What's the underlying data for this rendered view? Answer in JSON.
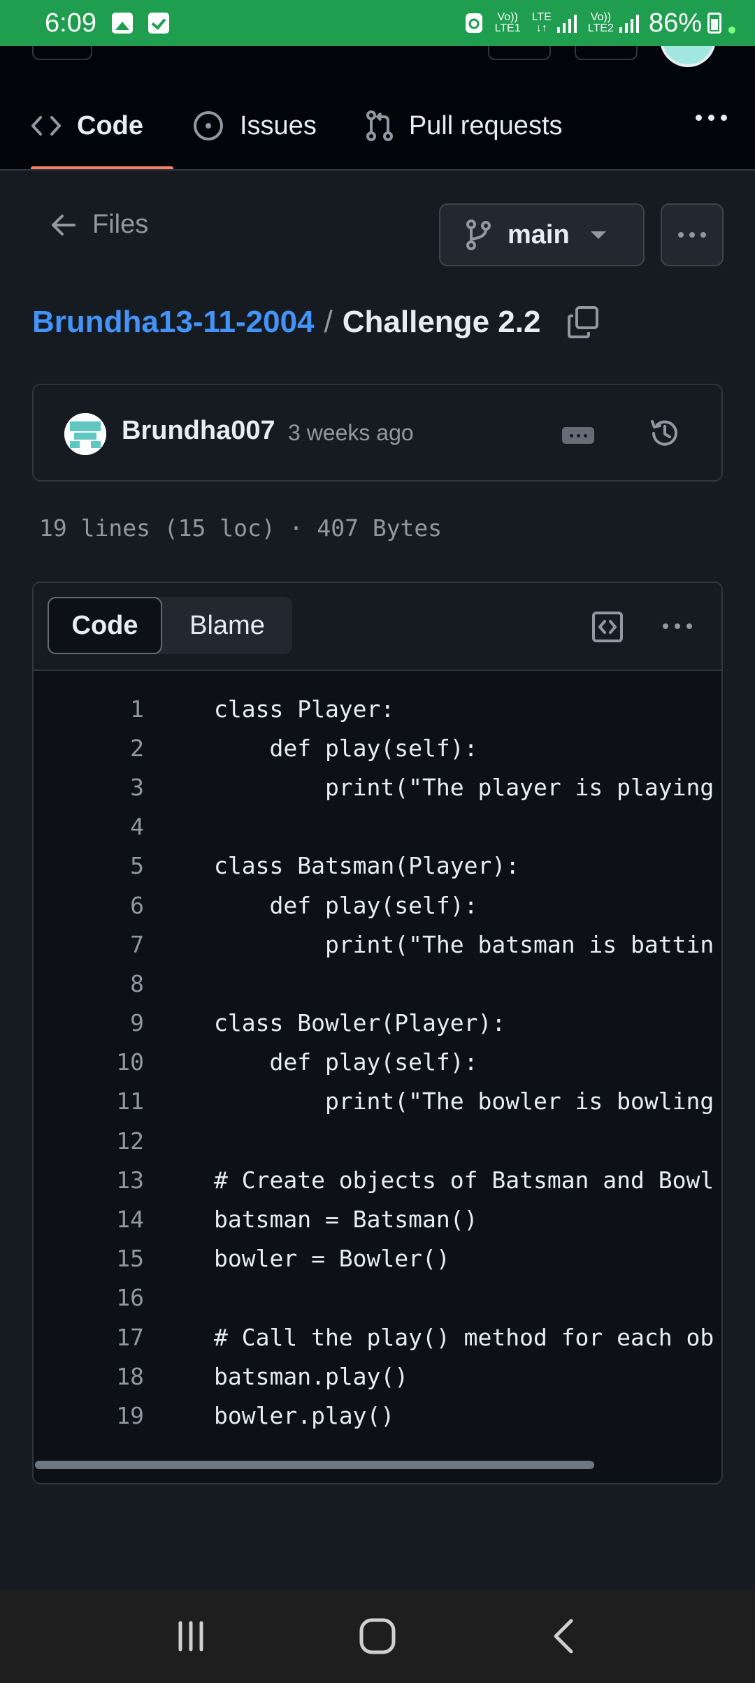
{
  "status_bar": {
    "time": "6:09",
    "net1_top": "Vo))",
    "net1_bottom": "LTE1",
    "net_lte_top": "LTE",
    "net_lte_bottom": "↓↑",
    "net2_top": "Vo))",
    "net2_bottom": "LTE2",
    "battery": "86%"
  },
  "repo_header": {
    "tabs": [
      {
        "label": "Code",
        "icon": "code-icon",
        "active": true
      },
      {
        "label": "Issues",
        "icon": "issue-icon",
        "active": false
      },
      {
        "label": "Pull requests",
        "icon": "pull-request-icon",
        "active": false
      }
    ],
    "more_icon": "kebab-horizontal-icon"
  },
  "nav": {
    "back_label": "Files",
    "branch": "main"
  },
  "breadcrumb": {
    "repo": "Brundha13-11-2004",
    "separator": "/",
    "file": "Challenge 2.2"
  },
  "commit": {
    "author": "Brundha007",
    "time": "3 weeks ago"
  },
  "file_info": "19 lines (15 loc) · 407 Bytes",
  "code_view": {
    "tab_code": "Code",
    "tab_blame": "Blame",
    "lines": [
      {
        "n": "1",
        "text": "class Player:"
      },
      {
        "n": "2",
        "text": "    def play(self):"
      },
      {
        "n": "3",
        "text": "        print(\"The player is playing"
      },
      {
        "n": "4",
        "text": ""
      },
      {
        "n": "5",
        "text": "class Batsman(Player):"
      },
      {
        "n": "6",
        "text": "    def play(self):"
      },
      {
        "n": "7",
        "text": "        print(\"The batsman is battin"
      },
      {
        "n": "8",
        "text": ""
      },
      {
        "n": "9",
        "text": "class Bowler(Player):"
      },
      {
        "n": "10",
        "text": "    def play(self):"
      },
      {
        "n": "11",
        "text": "        print(\"The bowler is bowling"
      },
      {
        "n": "12",
        "text": ""
      },
      {
        "n": "13",
        "text": "# Create objects of Batsman and Bowl"
      },
      {
        "n": "14",
        "text": "batsman = Batsman()"
      },
      {
        "n": "15",
        "text": "bowler = Bowler()"
      },
      {
        "n": "16",
        "text": ""
      },
      {
        "n": "17",
        "text": "# Call the play() method for each ob"
      },
      {
        "n": "18",
        "text": "batsman.play()"
      },
      {
        "n": "19",
        "text": "bowler.play()"
      }
    ]
  },
  "colors": {
    "status_bar": "#1e9e4e",
    "link": "#4493f8",
    "tab_underline": "#f78166",
    "background": "#161b22",
    "code_background": "#0d1117"
  }
}
